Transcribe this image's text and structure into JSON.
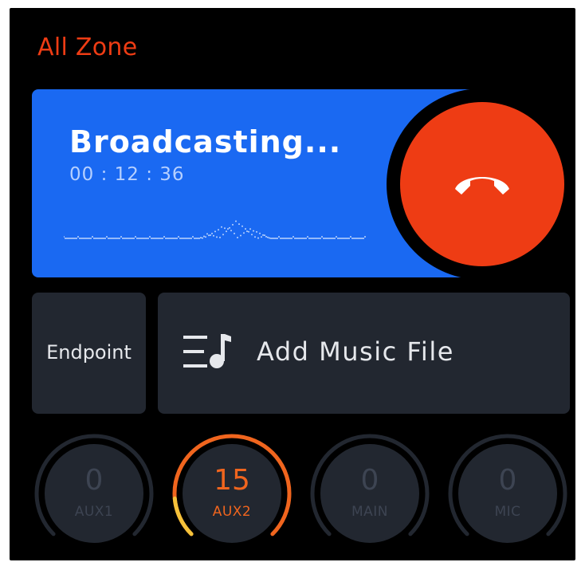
{
  "zone": {
    "title": "All Zone"
  },
  "broadcast": {
    "status": "Broadcasting...",
    "elapsed": "00 : 12 : 36",
    "hangup_icon": "phone-hangup-icon"
  },
  "actions": {
    "endpoint_label": "Endpoint",
    "add_music_label": "Add Music File",
    "add_music_icon": "playlist-music-icon"
  },
  "channels": [
    {
      "name": "AUX1",
      "level": 0,
      "active": false
    },
    {
      "name": "AUX2",
      "level": 15,
      "active": true
    },
    {
      "name": "MAIN",
      "level": 0,
      "active": false
    },
    {
      "name": "MIC",
      "level": 0,
      "active": false
    }
  ],
  "colors": {
    "accent_red": "#ee3c14",
    "broadcast_blue": "#1a69f2",
    "knob_active": "#f0651e",
    "tile_bg": "#222730"
  }
}
